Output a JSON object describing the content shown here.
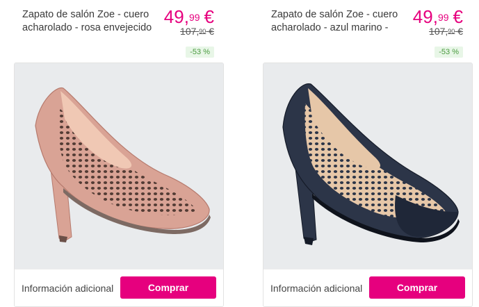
{
  "products": [
    {
      "title": "Zapato de salón Zoe - cuero acharolado - rosa envejecido",
      "price_int": "49",
      "price_dec": "99",
      "currency": "€",
      "old_int": "107,",
      "old_dec": "90",
      "old_currency": "€",
      "discount": "-53 %",
      "info_label": "Información adicional",
      "buy_label": "Comprar",
      "shoe_color": "#d9a395",
      "shoe_dark": "#b67a6d",
      "lining_color": "#f0c8b4"
    },
    {
      "title": "Zapato de salón Zoe - cuero acharolado - azul marino -",
      "price_int": "49",
      "price_dec": "99",
      "currency": "€",
      "old_int": "107,",
      "old_dec": "90",
      "old_currency": "€",
      "discount": "-53 %",
      "info_label": "Información adicional",
      "buy_label": "Comprar",
      "shoe_color": "#2c3548",
      "shoe_dark": "#151b28",
      "lining_color": "#e6c7a8"
    }
  ]
}
